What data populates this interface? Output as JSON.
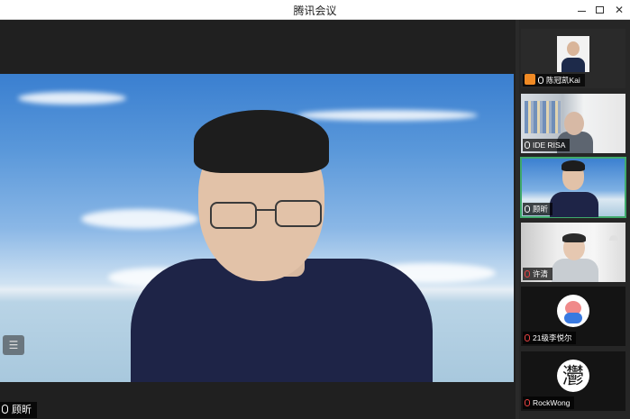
{
  "window": {
    "title": "腾讯会议"
  },
  "main_video": {
    "speaker_name": "顾昕",
    "menu_glyph": "☰"
  },
  "participants": [
    {
      "name": "陈冠凯Kai",
      "muted": false,
      "has_badge": true
    },
    {
      "name": "IDE RISA",
      "muted": false,
      "has_badge": false
    },
    {
      "name": "顾昕",
      "muted": false,
      "has_badge": false,
      "active": true
    },
    {
      "name": "许清",
      "muted": true,
      "has_badge": false
    },
    {
      "name": "21级李悦尔",
      "muted": true,
      "has_badge": false
    },
    {
      "name": "RockWong",
      "muted": true,
      "has_badge": false,
      "avatar_text": "灪"
    }
  ],
  "colors": {
    "active_outline": "#3fa96b",
    "badge": "#f08a24",
    "muted_mic": "#e44"
  }
}
